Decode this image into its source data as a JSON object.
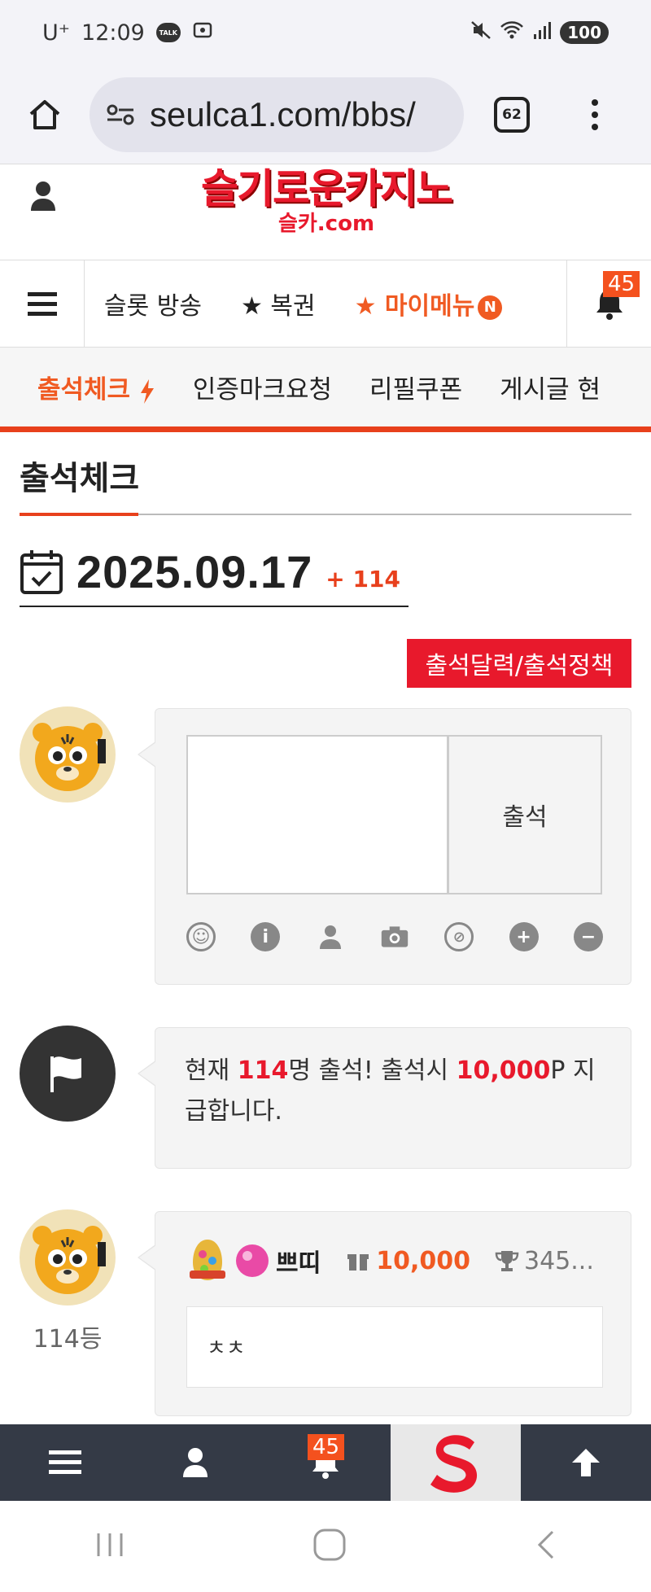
{
  "status": {
    "carrier": "U⁺",
    "time": "12:09",
    "talk": "TALK",
    "battery": "100"
  },
  "browser": {
    "url": "seulca1.com/bbs/",
    "tab_count": "62"
  },
  "site": {
    "logo_main": "슬기로운카지노",
    "logo_sub": "슬카.com"
  },
  "nav1": {
    "items": [
      "슬롯 방송",
      "★ 복권",
      "★ 마이메뉴"
    ],
    "new_badge": "N",
    "notif_count": "45"
  },
  "nav2": {
    "items": [
      "출석체크",
      "인증마크요청",
      "리필쿠폰",
      "게시글 현"
    ]
  },
  "page": {
    "title": "출석체크",
    "date": "2025.09.17",
    "date_plus": "+ 114",
    "policy_button": "출석달력/출석정책",
    "submit_label": "출석"
  },
  "notice": {
    "p1": "현재 ",
    "count": "114",
    "p2": "명 출석! 출석시 ",
    "points": "10,000",
    "p3": "P 지급합니다."
  },
  "entry": {
    "rank": "114등",
    "nickname": "쁘띠",
    "points": "10,000",
    "trophy": "345...",
    "comment": "ㅊㅊ"
  },
  "bottom": {
    "notif_count": "45"
  },
  "colors": {
    "accent": "#f05a22",
    "brand_red": "#e8192c",
    "bar": "#343a46"
  }
}
